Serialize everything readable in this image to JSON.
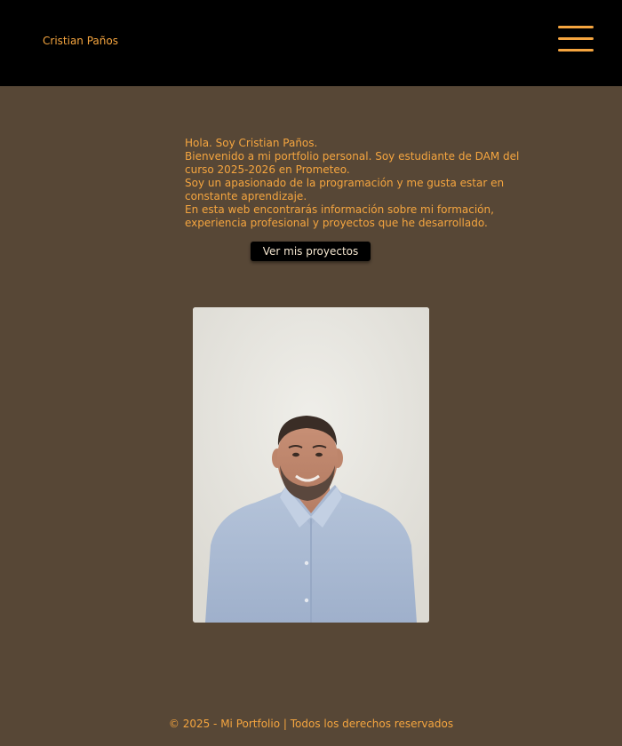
{
  "header": {
    "brand": "Cristian Paños",
    "menu_icon": "hamburger-menu-icon"
  },
  "intro": {
    "lines": [
      "Hola. Soy Cristian Paños.",
      "Bienvenido a mi portfolio personal. Soy estudiante de DAM del curso 2025-2026 en Prometeo.",
      "Soy un apasionado de la programación y me gusta estar en constante aprendizaje.",
      "En esta web encontrarás información sobre mi formación, experiencia profesional y proyectos que he desarrollado."
    ],
    "cta_label": "Ver mis proyectos"
  },
  "photo": {
    "subject": "profile-photo"
  },
  "footer": {
    "text": "© 2025 - Mi Portfolio | Todos los derechos reservados"
  },
  "colors": {
    "background": "#574736",
    "header_bg": "#000000",
    "accent": "#f5a53f",
    "button_bg": "#000000",
    "button_text": "#f5e6cf"
  }
}
